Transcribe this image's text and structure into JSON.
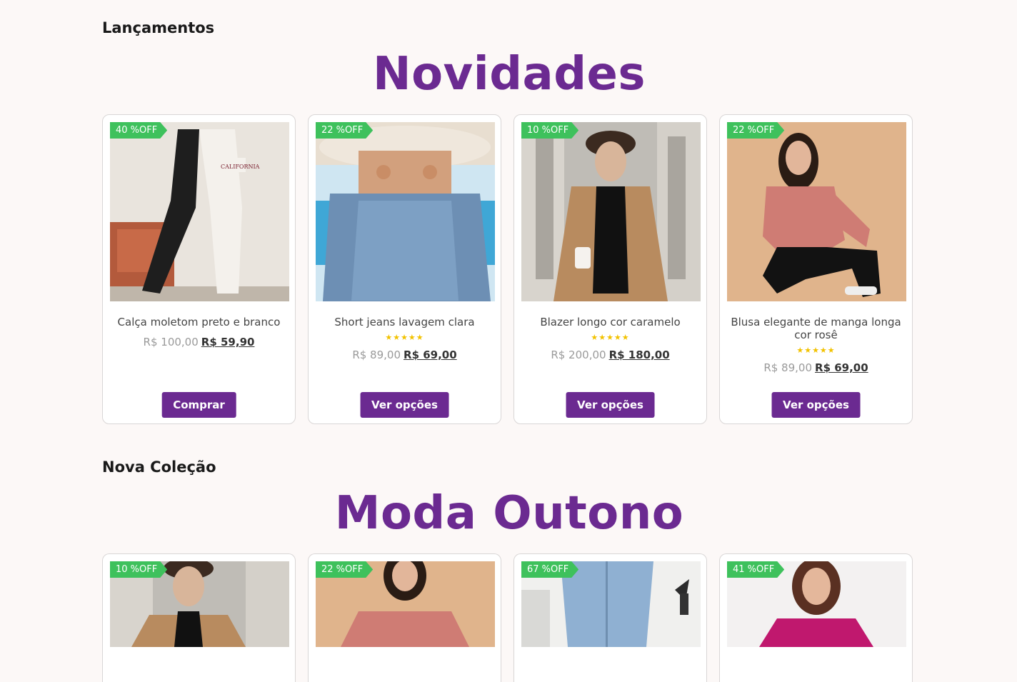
{
  "colors": {
    "background": "#fcf8f7",
    "accent": "#6b2a91",
    "badge": "#3ec15c",
    "star": "#f2c200"
  },
  "sections": [
    {
      "eyebrow": "Lançamentos",
      "headline": "Novidades",
      "products": [
        {
          "badge": "40 %OFF",
          "title": "Calça moletom preto e branco",
          "stars": "",
          "old_price": "R$ 100,00",
          "new_price": "R$ 59,90",
          "button": "Comprar"
        },
        {
          "badge": "22 %OFF",
          "title": "Short jeans lavagem clara",
          "stars": "★★★★★",
          "old_price": "R$ 89,00",
          "new_price": "R$ 69,00",
          "button": "Ver opções"
        },
        {
          "badge": "10 %OFF",
          "title": "Blazer longo cor caramelo",
          "stars": "★★★★★",
          "old_price": "R$ 200,00",
          "new_price": "R$ 180,00",
          "button": "Ver opções"
        },
        {
          "badge": "22 %OFF",
          "title": "Blusa elegante de manga longa cor rosê",
          "stars": "★★★★★",
          "old_price": "R$ 89,00",
          "new_price": "R$ 69,00",
          "button": "Ver opções"
        }
      ]
    },
    {
      "eyebrow": "Nova Coleção",
      "headline": "Moda Outono",
      "products": [
        {
          "badge": "10 %OFF"
        },
        {
          "badge": "22 %OFF"
        },
        {
          "badge": "67 %OFF"
        },
        {
          "badge": "41 %OFF"
        }
      ]
    }
  ]
}
